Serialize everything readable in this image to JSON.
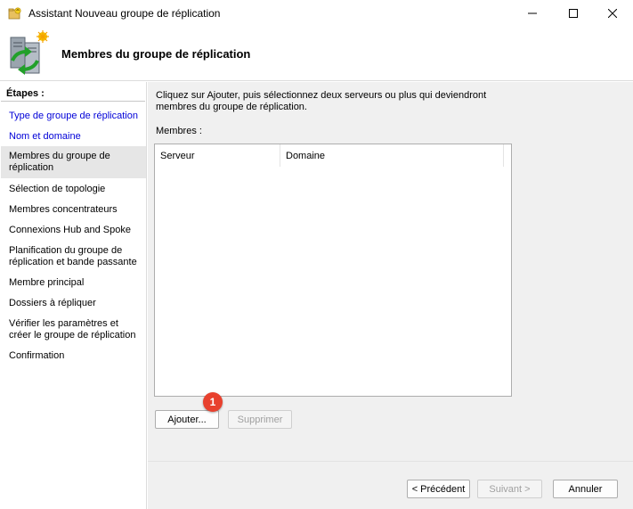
{
  "window": {
    "title": "Assistant Nouveau groupe de réplication",
    "controls": {
      "minimize_icon": "minimize-icon",
      "maximize_icon": "maximize-icon",
      "close_icon": "close-icon"
    }
  },
  "header": {
    "title": "Membres du groupe de réplication",
    "icon": "server-replication-icon"
  },
  "sidebar": {
    "header": "Étapes :",
    "steps": [
      {
        "label": "Type de groupe de réplication",
        "state": "completed"
      },
      {
        "label": "Nom et domaine",
        "state": "completed"
      },
      {
        "label": "Membres du groupe de réplication",
        "state": "current"
      },
      {
        "label": "Sélection de topologie",
        "state": "pending"
      },
      {
        "label": "Membres concentrateurs",
        "state": "pending"
      },
      {
        "label": "Connexions Hub and Spoke",
        "state": "pending"
      },
      {
        "label": "Planification du groupe de réplication et bande passante",
        "state": "pending"
      },
      {
        "label": "Membre principal",
        "state": "pending"
      },
      {
        "label": "Dossiers à répliquer",
        "state": "pending"
      },
      {
        "label": "Vérifier les paramètres et créer le groupe de réplication",
        "state": "pending"
      },
      {
        "label": "Confirmation",
        "state": "pending"
      }
    ]
  },
  "main": {
    "instructions": "Cliquez sur Ajouter, puis sélectionnez deux serveurs ou plus qui deviendront membres du groupe de réplication.",
    "members_label": "Membres :",
    "columns": [
      "Serveur",
      "Domaine"
    ],
    "rows": [],
    "add_button": "Ajouter...",
    "remove_button": "Supprimer",
    "annotation_badge": "1"
  },
  "footer": {
    "previous": "< Précédent",
    "next": "Suivant >",
    "cancel": "Annuler"
  },
  "colors": {
    "link": "#0000d8",
    "current_step_bg": "#e6e6e6",
    "content_bg": "#f0f0f0",
    "badge": "#e8412e"
  }
}
